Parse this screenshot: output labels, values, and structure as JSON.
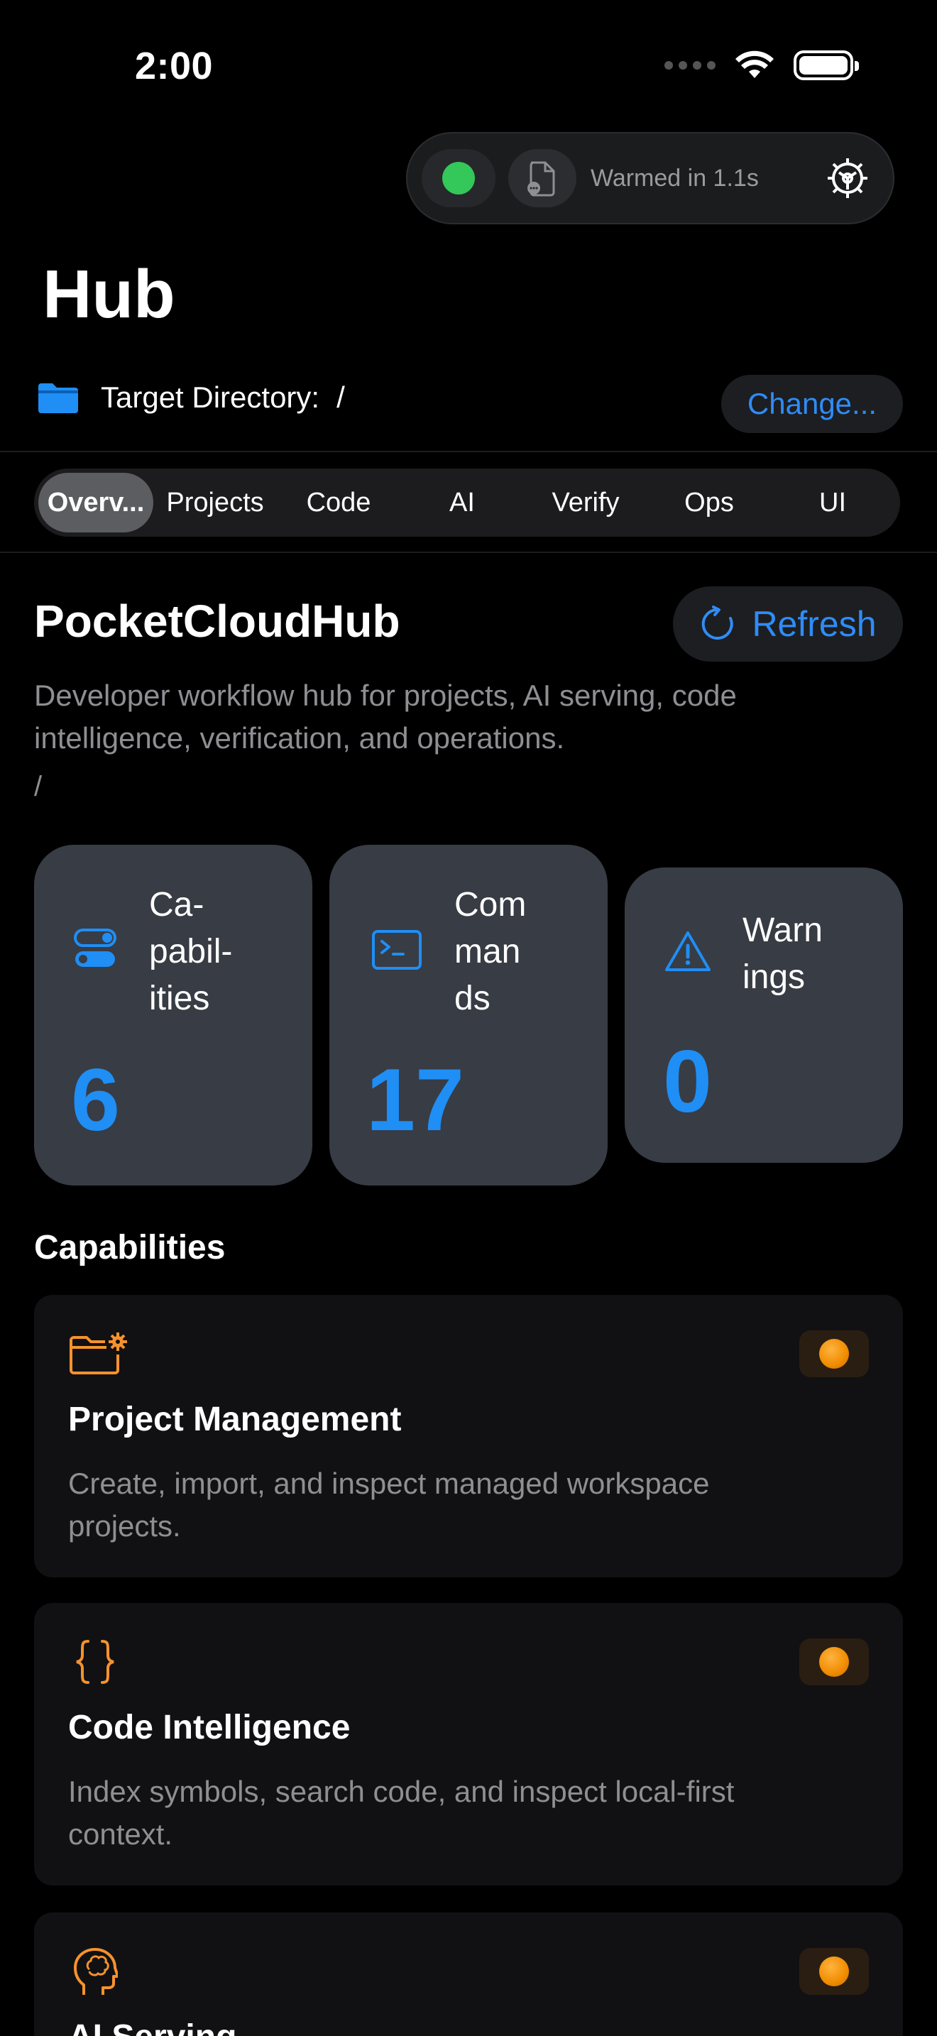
{
  "status_bar": {
    "time": "2:00"
  },
  "toolbar": {
    "warm_text": "Warmed in 1.1s"
  },
  "page": {
    "title": "Hub"
  },
  "target_directory": {
    "label": "Target Directory:",
    "value": "/",
    "change_label": "Change..."
  },
  "tabs": [
    {
      "label": "Overv...",
      "active": true
    },
    {
      "label": "Projects"
    },
    {
      "label": "Code"
    },
    {
      "label": "AI"
    },
    {
      "label": "Verify"
    },
    {
      "label": "Ops"
    },
    {
      "label": "UI"
    }
  ],
  "header": {
    "name": "PocketCloudHub",
    "refresh_label": "Refresh",
    "description": "Developer workflow hub for projects, AI serving, code intelligence, verification, and operations.",
    "path": "/"
  },
  "stats": [
    {
      "label": "Ca-\npabil-\nities",
      "value": "6",
      "icon": "toggle-icon"
    },
    {
      "label": "Com\nman\nds",
      "value": "17",
      "icon": "terminal-icon"
    },
    {
      "label": "Warn\nings",
      "value": "0",
      "icon": "warning-icon"
    }
  ],
  "capabilities_section": {
    "title": "Capabilities"
  },
  "capabilities": [
    {
      "title": "Project Management",
      "description": "Create, import, and inspect managed workspace projects.",
      "icon": "folder-gear-icon"
    },
    {
      "title": "Code Intelligence",
      "description": "Index symbols, search code, and inspect local-first context.",
      "icon": "braces-icon"
    },
    {
      "title": "AI Serving",
      "description": "",
      "icon": "brain-head-icon"
    }
  ],
  "colors": {
    "accent": "#2f8cf6",
    "status_green": "#34c759",
    "status_orange": "#f08c00",
    "card_bg": "#383c44"
  }
}
